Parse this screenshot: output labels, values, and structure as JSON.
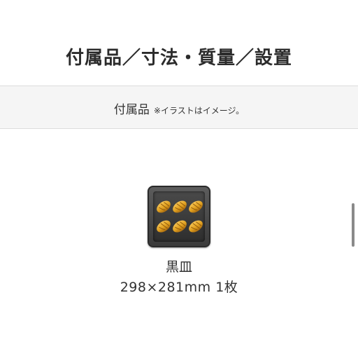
{
  "section": {
    "title": "付属品／寸法・質量／設置"
  },
  "accessories_band": {
    "label": "付属品",
    "note": "※イラストはイメージ。"
  },
  "item": {
    "icon": "black-tray-with-croissants",
    "name": "黒皿",
    "spec": "298×281mm 1枚"
  },
  "colors": {
    "band_background": "#f5f5f5",
    "tray_dark": "#3a3a3a",
    "croissant": "#e0a020"
  }
}
